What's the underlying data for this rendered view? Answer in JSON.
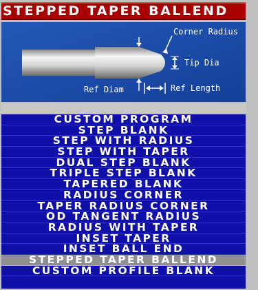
{
  "window": {
    "title": "STEPPED TAPER BALLEND"
  },
  "diagram": {
    "labels": {
      "corner_radius": "Corner Radius",
      "tip_dia": "Tip Dia",
      "ref_diam": "Ref Diam",
      "ref_length": "Ref Length"
    },
    "colors": {
      "background": "#1b4fb0",
      "shank": "#d8d8d8",
      "annotation": "#ffffff"
    }
  },
  "menu": {
    "items": [
      {
        "label": "CUSTOM PROGRAM"
      },
      {
        "label": "STEP BLANK"
      },
      {
        "label": "STEP WITH RADIUS"
      },
      {
        "label": "STEP WITH TAPER"
      },
      {
        "label": "DUAL STEP BLANK"
      },
      {
        "label": "TRIPLE STEP BLANK"
      },
      {
        "label": "TAPERED BLANK"
      },
      {
        "label": "RADIUS CORNER"
      },
      {
        "label": "TAPER RADIUS CORNER"
      },
      {
        "label": "OD TANGENT RADIUS"
      },
      {
        "label": "RADIUS WITH TAPER"
      },
      {
        "label": "INSET TAPER"
      },
      {
        "label": "INSET BALL END"
      },
      {
        "label": "STEPPED TAPER BALLEND",
        "selected": true
      },
      {
        "label": "CUSTOM PROFILE BLANK"
      }
    ]
  },
  "colors": {
    "title_bg": "#a80000",
    "menu_bg": "#1010a8",
    "selected_bg": "#909090",
    "text": "#ffffff"
  }
}
